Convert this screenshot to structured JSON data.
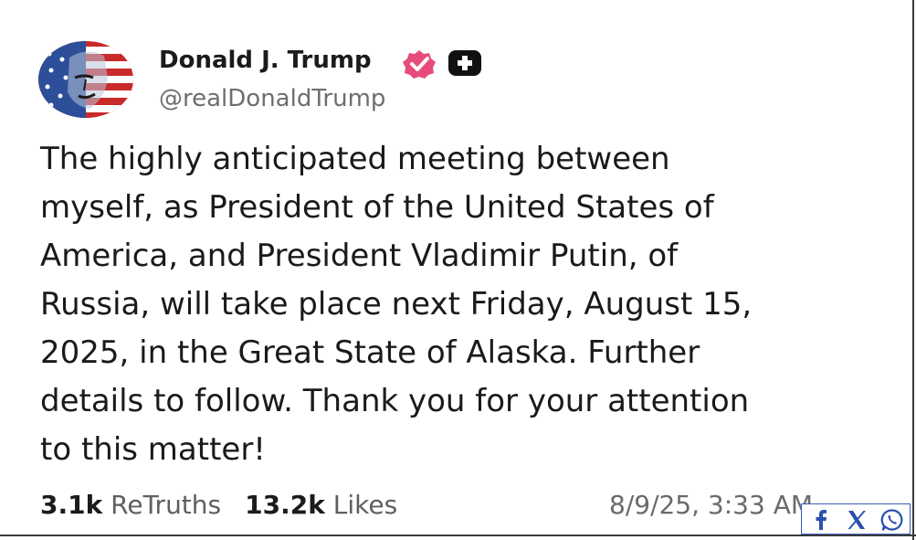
{
  "author": {
    "name": "Donald J. Trump",
    "handle": "@realDonaldTrump",
    "verified_color": "#e64c7a"
  },
  "post": {
    "lines": [
      "The highly anticipated meeting between",
      "myself, as President of the United States of",
      "America, and President Vladimir Putin, of",
      "Russia, will take place next Friday, August 15,",
      "2025, in the Great State of Alaska. Further",
      "details to follow. Thank you for your attention",
      "to this matter!"
    ]
  },
  "stats": {
    "retruths_count": "3.1k",
    "retruths_label": "ReTruths",
    "likes_count": "13.2k",
    "likes_label": "Likes",
    "timestamp": "8/9/25, 3:33 AM"
  },
  "share": {
    "buttons": [
      "facebook-icon",
      "x-icon",
      "whatsapp-icon"
    ],
    "color": "#2a4fae"
  }
}
